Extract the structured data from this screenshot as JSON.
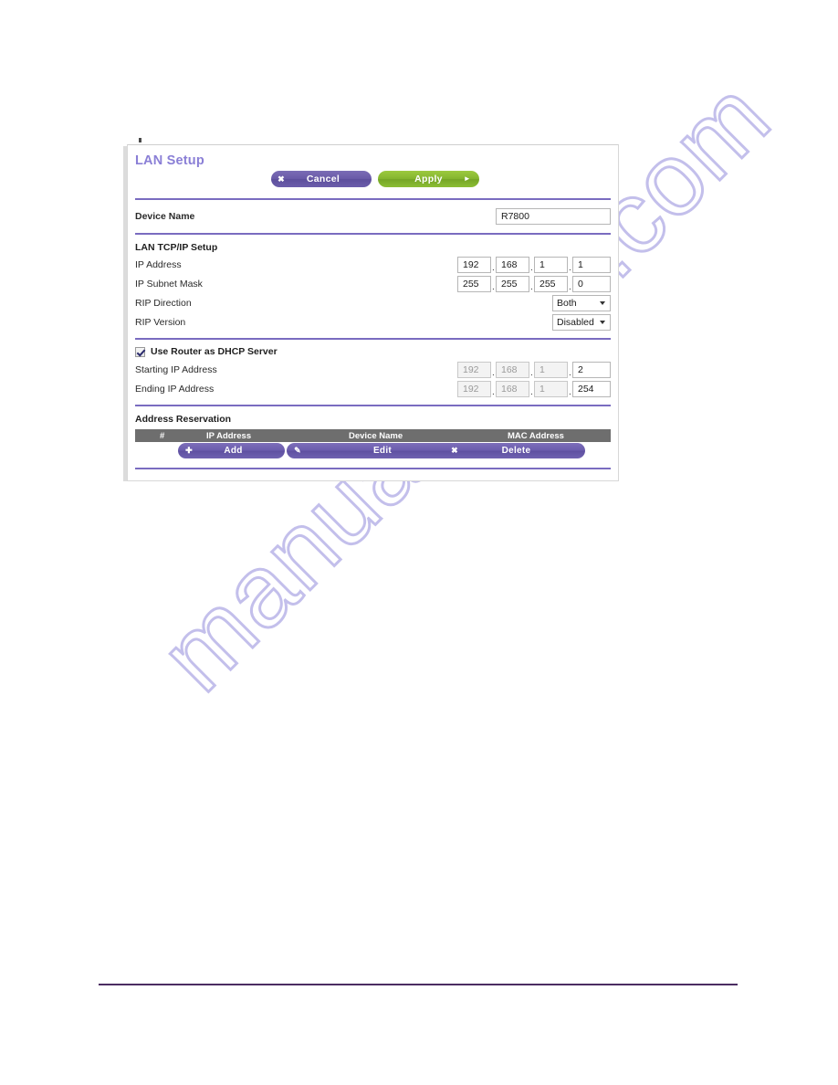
{
  "panel": {
    "title": "LAN Setup",
    "toolbar": {
      "cancel_label": "Cancel",
      "cancel_icon": "close-x-icon",
      "apply_label": "Apply",
      "apply_icon": "triangle-right-icon",
      "cancel_color": "#6a5ba8",
      "apply_color": "#85b62f"
    },
    "device_name": {
      "label": "Device Name",
      "value": "R7800"
    },
    "lan_tcpip": {
      "section_label": "LAN TCP/IP Setup",
      "ip_address": {
        "label": "IP Address",
        "octets": [
          "192",
          "168",
          "1",
          "1"
        ]
      },
      "ip_subnet_mask": {
        "label": "IP Subnet Mask",
        "octets": [
          "255",
          "255",
          "255",
          "0"
        ]
      },
      "rip_direction": {
        "label": "RIP Direction",
        "value": "Both"
      },
      "rip_version": {
        "label": "RIP Version",
        "value": "Disabled"
      }
    },
    "dhcp": {
      "checkbox_label": "Use Router as DHCP Server",
      "checked": true,
      "starting_ip": {
        "label": "Starting IP Address",
        "octets": [
          "192",
          "168",
          "1",
          "2"
        ]
      },
      "ending_ip": {
        "label": "Ending IP Address",
        "octets": [
          "192",
          "168",
          "1",
          "254"
        ]
      }
    },
    "address_reservation": {
      "section_label": "Address Reservation",
      "columns": [
        "#",
        "IP Address",
        "Device Name",
        "MAC Address"
      ],
      "rows": [],
      "buttons": {
        "add_label": "Add",
        "add_icon": "plus-icon",
        "edit_label": "Edit",
        "edit_icon": "pencil-icon",
        "delete_label": "Delete",
        "delete_icon": "close-x-icon"
      }
    }
  },
  "watermark": {
    "text": "manualshive.com",
    "color": "#b9b5e8"
  }
}
